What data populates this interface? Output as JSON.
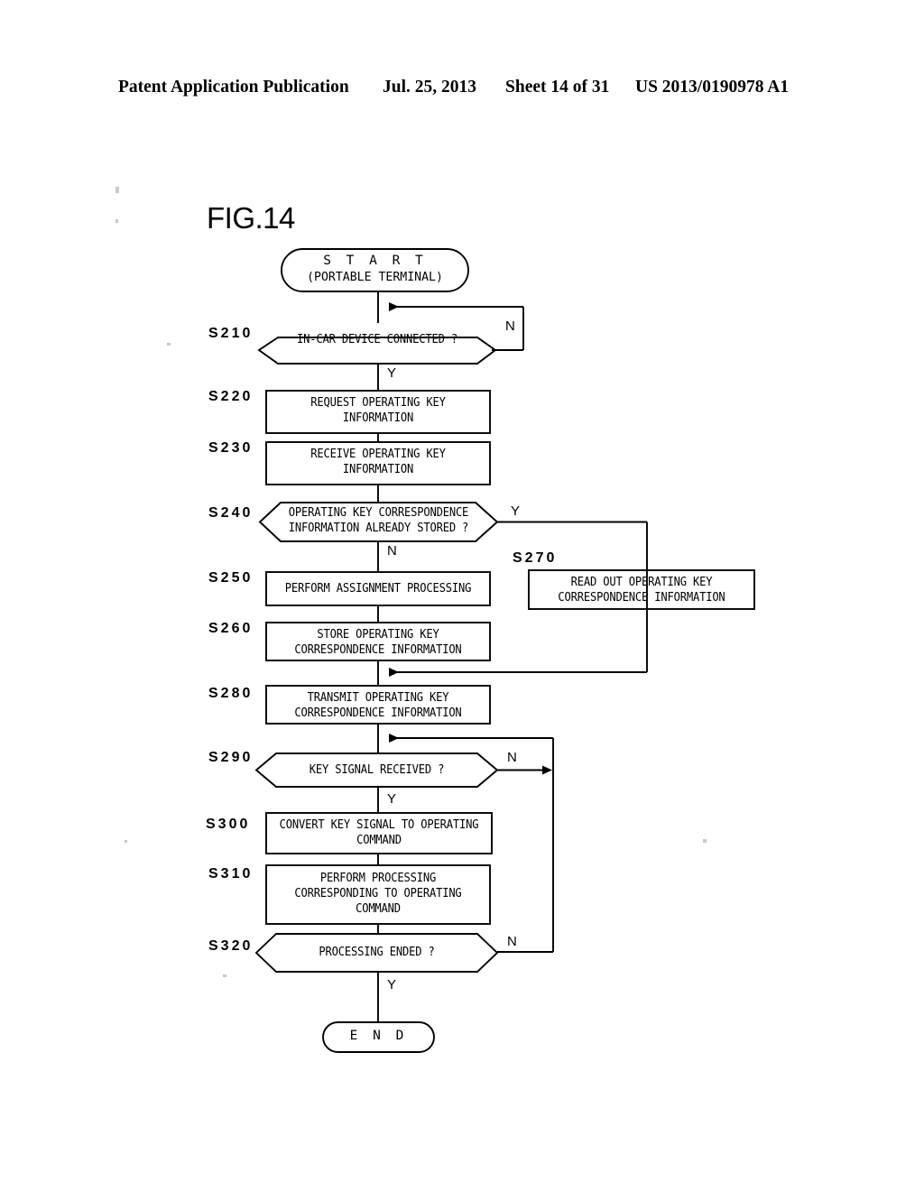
{
  "header": {
    "publication": "Patent Application Publication",
    "date": "Jul. 25, 2013",
    "sheet": "Sheet 14 of 31",
    "number": "US 2013/0190978 A1"
  },
  "figure": {
    "label": "FIG.14"
  },
  "flowchart": {
    "type": "flowchart",
    "colors": {
      "line": "#000000",
      "background": "#ffffff"
    },
    "terminals": {
      "start_line1": "S T A R T",
      "start_line2": "(PORTABLE TERMINAL)",
      "end": "E N D"
    },
    "branches": {
      "yes": "Y",
      "no": "N"
    },
    "steps": [
      {
        "id": "S210",
        "shape": "decision",
        "lines": [
          "IN-CAR DEVICE CONNECTED ?"
        ],
        "yes_to": "S220",
        "no_to": "S210"
      },
      {
        "id": "S220",
        "shape": "process",
        "lines": [
          "REQUEST OPERATING KEY",
          "INFORMATION"
        ]
      },
      {
        "id": "S230",
        "shape": "process",
        "lines": [
          "RECEIVE OPERATING KEY",
          "INFORMATION"
        ]
      },
      {
        "id": "S240",
        "shape": "decision",
        "lines": [
          "OPERATING KEY CORRESPONDENCE",
          "INFORMATION ALREADY STORED ?"
        ],
        "yes_to": "S270",
        "no_to": "S250"
      },
      {
        "id": "S250",
        "shape": "process",
        "lines": [
          "PERFORM ASSIGNMENT PROCESSING"
        ]
      },
      {
        "id": "S260",
        "shape": "process",
        "lines": [
          "STORE OPERATING KEY",
          "CORRESPONDENCE INFORMATION"
        ]
      },
      {
        "id": "S270",
        "shape": "process",
        "lines": [
          "READ OUT OPERATING KEY",
          "CORRESPONDENCE INFORMATION"
        ]
      },
      {
        "id": "S280",
        "shape": "process",
        "lines": [
          "TRANSMIT OPERATING KEY",
          "CORRESPONDENCE INFORMATION"
        ]
      },
      {
        "id": "S290",
        "shape": "decision",
        "lines": [
          "KEY SIGNAL RECEIVED ?"
        ],
        "yes_to": "S300",
        "no_to": "S290"
      },
      {
        "id": "S300",
        "shape": "process",
        "lines": [
          "CONVERT KEY SIGNAL TO OPERATING",
          "COMMAND"
        ]
      },
      {
        "id": "S310",
        "shape": "process",
        "lines": [
          "PERFORM PROCESSING",
          "CORRESPONDING TO OPERATING",
          "COMMAND"
        ]
      },
      {
        "id": "S320",
        "shape": "decision",
        "lines": [
          "PROCESSING ENDED ?"
        ],
        "yes_to": "END",
        "no_to": "S290"
      }
    ]
  }
}
